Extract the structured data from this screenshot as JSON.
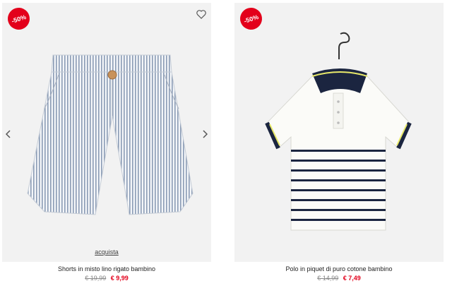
{
  "products": [
    {
      "name": "Shorts in misto lino rigato bambino",
      "discount": "-50%",
      "old_price": "€ 19,99",
      "new_price": "€ 9,99",
      "buy_label": "acquista"
    },
    {
      "name": "Polo in piquet di puro cotone bambino",
      "discount": "-50%",
      "old_price": "€ 14,99",
      "new_price": "€ 7,49"
    }
  ],
  "colors": {
    "badge": "#e3001b",
    "price_sale": "#e3001b",
    "image_bg": "#f2f2f2",
    "navy": "#1b2540",
    "polo_yellow": "#e8e96a"
  },
  "icons": [
    "heart-icon",
    "chevron-left-icon",
    "chevron-right-icon",
    "hanger-icon"
  ]
}
